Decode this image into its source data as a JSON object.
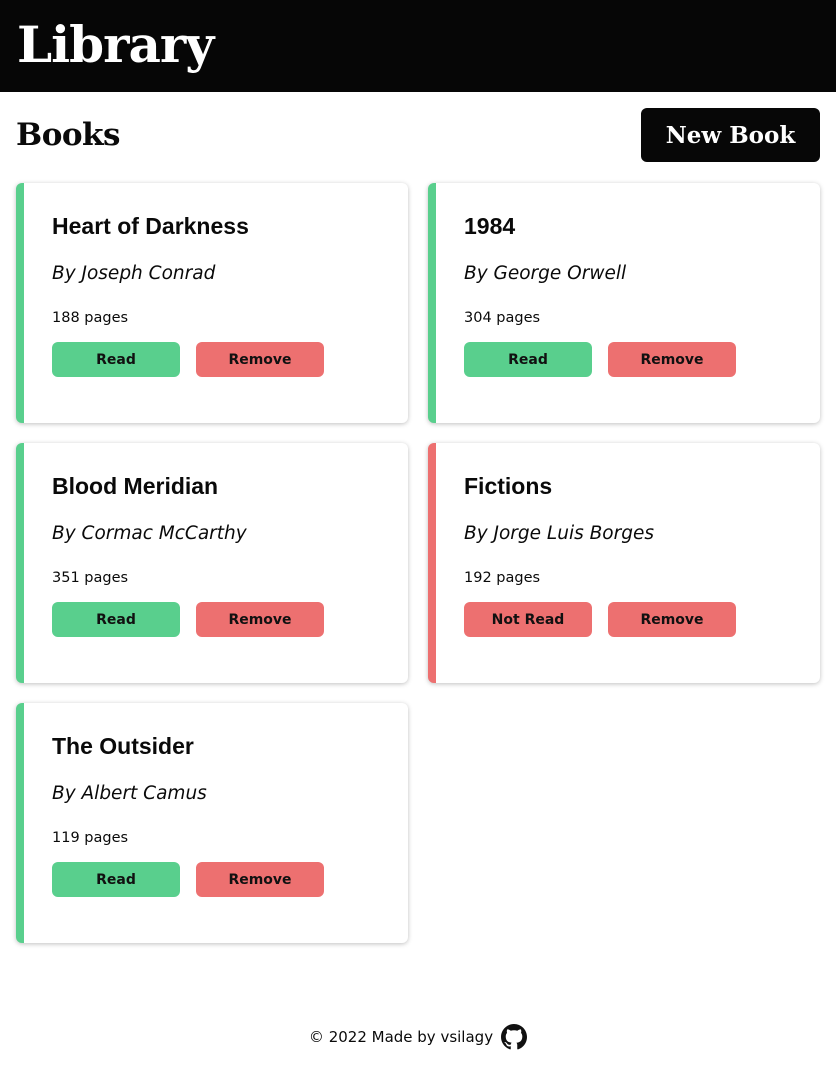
{
  "header": {
    "title": "Library"
  },
  "toolbar": {
    "heading": "Books",
    "new_book_label": "New Book"
  },
  "books": [
    {
      "title": "Heart of Darkness",
      "author": "By Joseph Conrad",
      "pages": "188 pages",
      "status_label": "Read",
      "remove_label": "Remove"
    },
    {
      "title": "1984",
      "author": "By George Orwell",
      "pages": "304 pages",
      "status_label": "Read",
      "remove_label": "Remove"
    },
    {
      "title": "Blood Meridian",
      "author": "By Cormac McCarthy",
      "pages": "351 pages",
      "status_label": "Read",
      "remove_label": "Remove"
    },
    {
      "title": "Fictions",
      "author": "By Jorge Luis Borges",
      "pages": "192 pages",
      "status_label": "Not Read",
      "remove_label": "Remove"
    },
    {
      "title": "The Outsider",
      "author": "By Albert Camus",
      "pages": "119 pages",
      "status_label": "Read",
      "remove_label": "Remove"
    }
  ],
  "footer": {
    "text": "© 2022 Made by vsilagy",
    "icon": "github-icon"
  },
  "colors": {
    "read": "#59cf8d",
    "not_read": "#ed7070",
    "header_bg": "#060606"
  }
}
